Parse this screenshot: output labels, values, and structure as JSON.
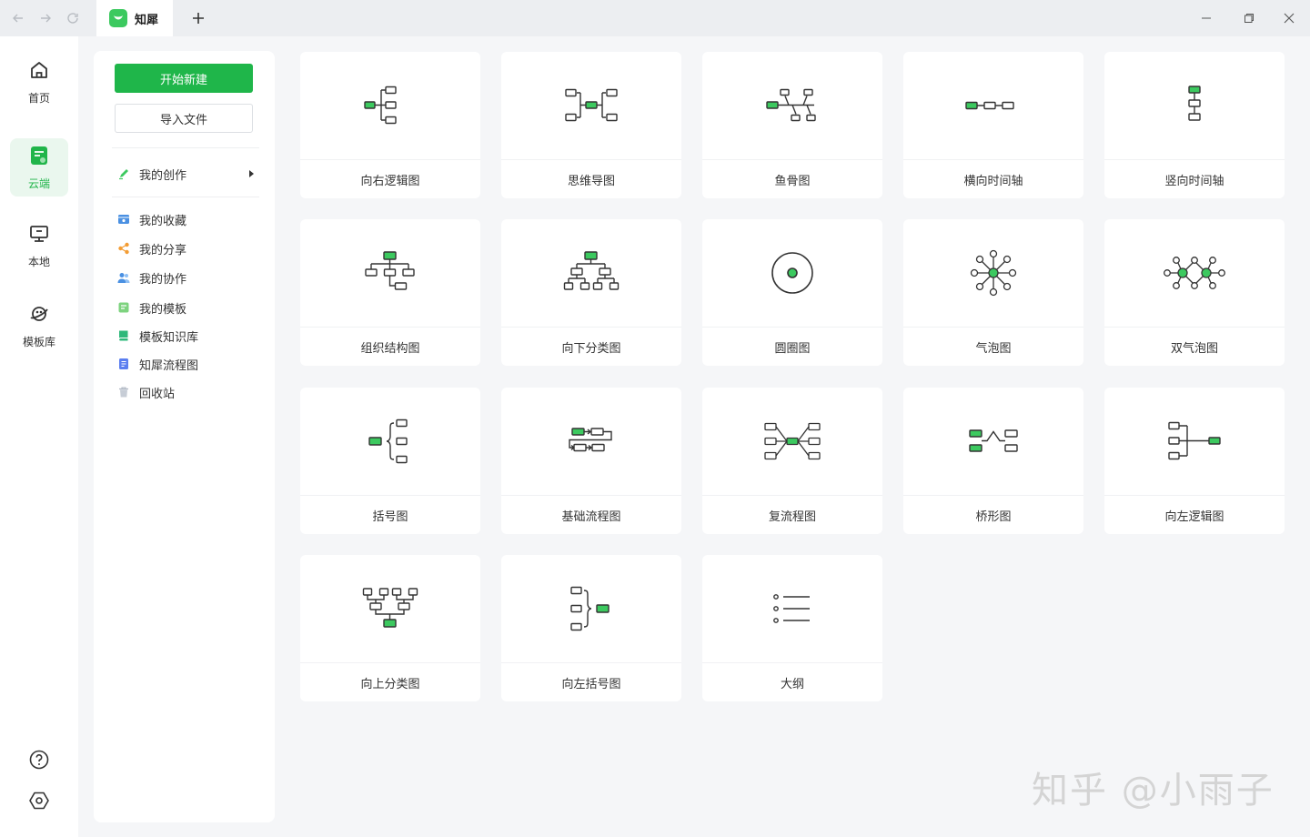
{
  "titlebar": {
    "tab_title": "知犀",
    "icons": {
      "back": "arrow-left-icon",
      "forward": "arrow-right-icon",
      "reload": "reload-icon",
      "new_tab": "plus-icon",
      "minimize": "minimize-icon",
      "restore": "restore-icon",
      "close": "close-icon"
    }
  },
  "rail": {
    "items": [
      {
        "label": "首页",
        "icon": "home-icon"
      },
      {
        "label": "云端",
        "icon": "cloud-doc-icon"
      },
      {
        "label": "本地",
        "icon": "monitor-icon"
      },
      {
        "label": "模板库",
        "icon": "planet-icon"
      }
    ],
    "active_index": 1,
    "bottom_icons": [
      "help-icon",
      "settings-icon"
    ]
  },
  "panel": {
    "new_button": "开始新建",
    "import_button": "导入文件",
    "items": [
      {
        "label": "我的创作",
        "icon": "pencil-icon",
        "color": "#3cc95f"
      },
      {
        "label": "我的收藏",
        "icon": "folder-star-icon",
        "color": "#4a90e2"
      },
      {
        "label": "我的分享",
        "icon": "share-icon",
        "color": "#f39c33"
      },
      {
        "label": "我的协作",
        "icon": "users-icon",
        "color": "#4a90e2"
      },
      {
        "label": "我的模板",
        "icon": "template-icon",
        "color": "#3cc95f"
      },
      {
        "label": "模板知识库",
        "icon": "book-icon",
        "color": "#2db87a"
      },
      {
        "label": "知犀流程图",
        "icon": "flowchart-doc-icon",
        "color": "#5b7ef0"
      },
      {
        "label": "回收站",
        "icon": "trash-icon",
        "color": "#b0b8c4"
      }
    ]
  },
  "templates": [
    {
      "label": "向右逻辑图",
      "icon": "logic-right-icon"
    },
    {
      "label": "思维导图",
      "icon": "mindmap-icon"
    },
    {
      "label": "鱼骨图",
      "icon": "fishbone-icon"
    },
    {
      "label": "横向时间轴",
      "icon": "timeline-horizontal-icon"
    },
    {
      "label": "竖向时间轴",
      "icon": "timeline-vertical-icon"
    },
    {
      "label": "组织结构图",
      "icon": "org-chart-icon"
    },
    {
      "label": "向下分类图",
      "icon": "tree-down-icon"
    },
    {
      "label": "圆圈图",
      "icon": "circle-map-icon"
    },
    {
      "label": "气泡图",
      "icon": "bubble-map-icon"
    },
    {
      "label": "双气泡图",
      "icon": "double-bubble-icon"
    },
    {
      "label": "括号图",
      "icon": "brace-map-icon"
    },
    {
      "label": "基础流程图",
      "icon": "basic-flow-icon"
    },
    {
      "label": "复流程图",
      "icon": "multi-flow-icon"
    },
    {
      "label": "桥形图",
      "icon": "bridge-map-icon"
    },
    {
      "label": "向左逻辑图",
      "icon": "logic-left-icon"
    },
    {
      "label": "向上分类图",
      "icon": "tree-up-icon"
    },
    {
      "label": "向左括号图",
      "icon": "brace-left-icon"
    },
    {
      "label": "大纲",
      "icon": "outline-icon"
    }
  ],
  "watermark": "知乎 @小雨子",
  "colors": {
    "accent": "#1fb64a",
    "node_fill": "#3cc95f",
    "rail_active_bg": "#eaf7ee"
  }
}
